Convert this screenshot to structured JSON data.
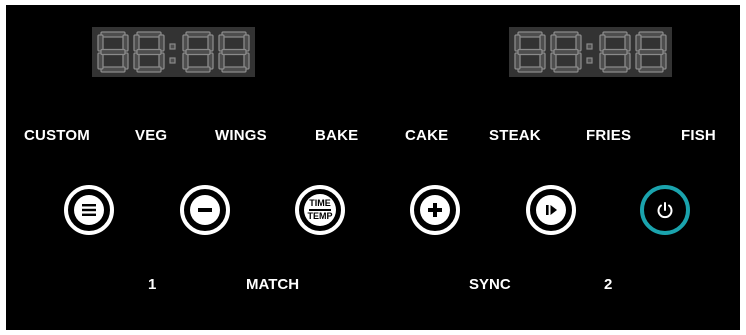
{
  "displays": [
    {
      "name": "left-display",
      "segments": "88:88"
    },
    {
      "name": "right-display",
      "segments": "88:88"
    }
  ],
  "presets": [
    "CUSTOM",
    "VEG",
    "WINGS",
    "BAKE",
    "CAKE",
    "STEAK",
    "FRIES",
    "FISH"
  ],
  "buttons": {
    "menu_icon": "menu-icon",
    "minus_icon": "minus-icon",
    "time_temp": {
      "top": "TIME",
      "bottom": "TEMP"
    },
    "plus_icon": "plus-icon",
    "start_pause_icon": "start-pause-icon",
    "power_icon": "power-icon"
  },
  "labels": {
    "zone1": "1",
    "match": "MATCH",
    "sync": "SYNC",
    "zone2": "2"
  },
  "colors": {
    "panel": "#000000",
    "display_bg": "#333333",
    "segment_off": "#4d4d4d",
    "segment_edge": "#8a8a8a",
    "power_ring": "#1aa3ad"
  }
}
